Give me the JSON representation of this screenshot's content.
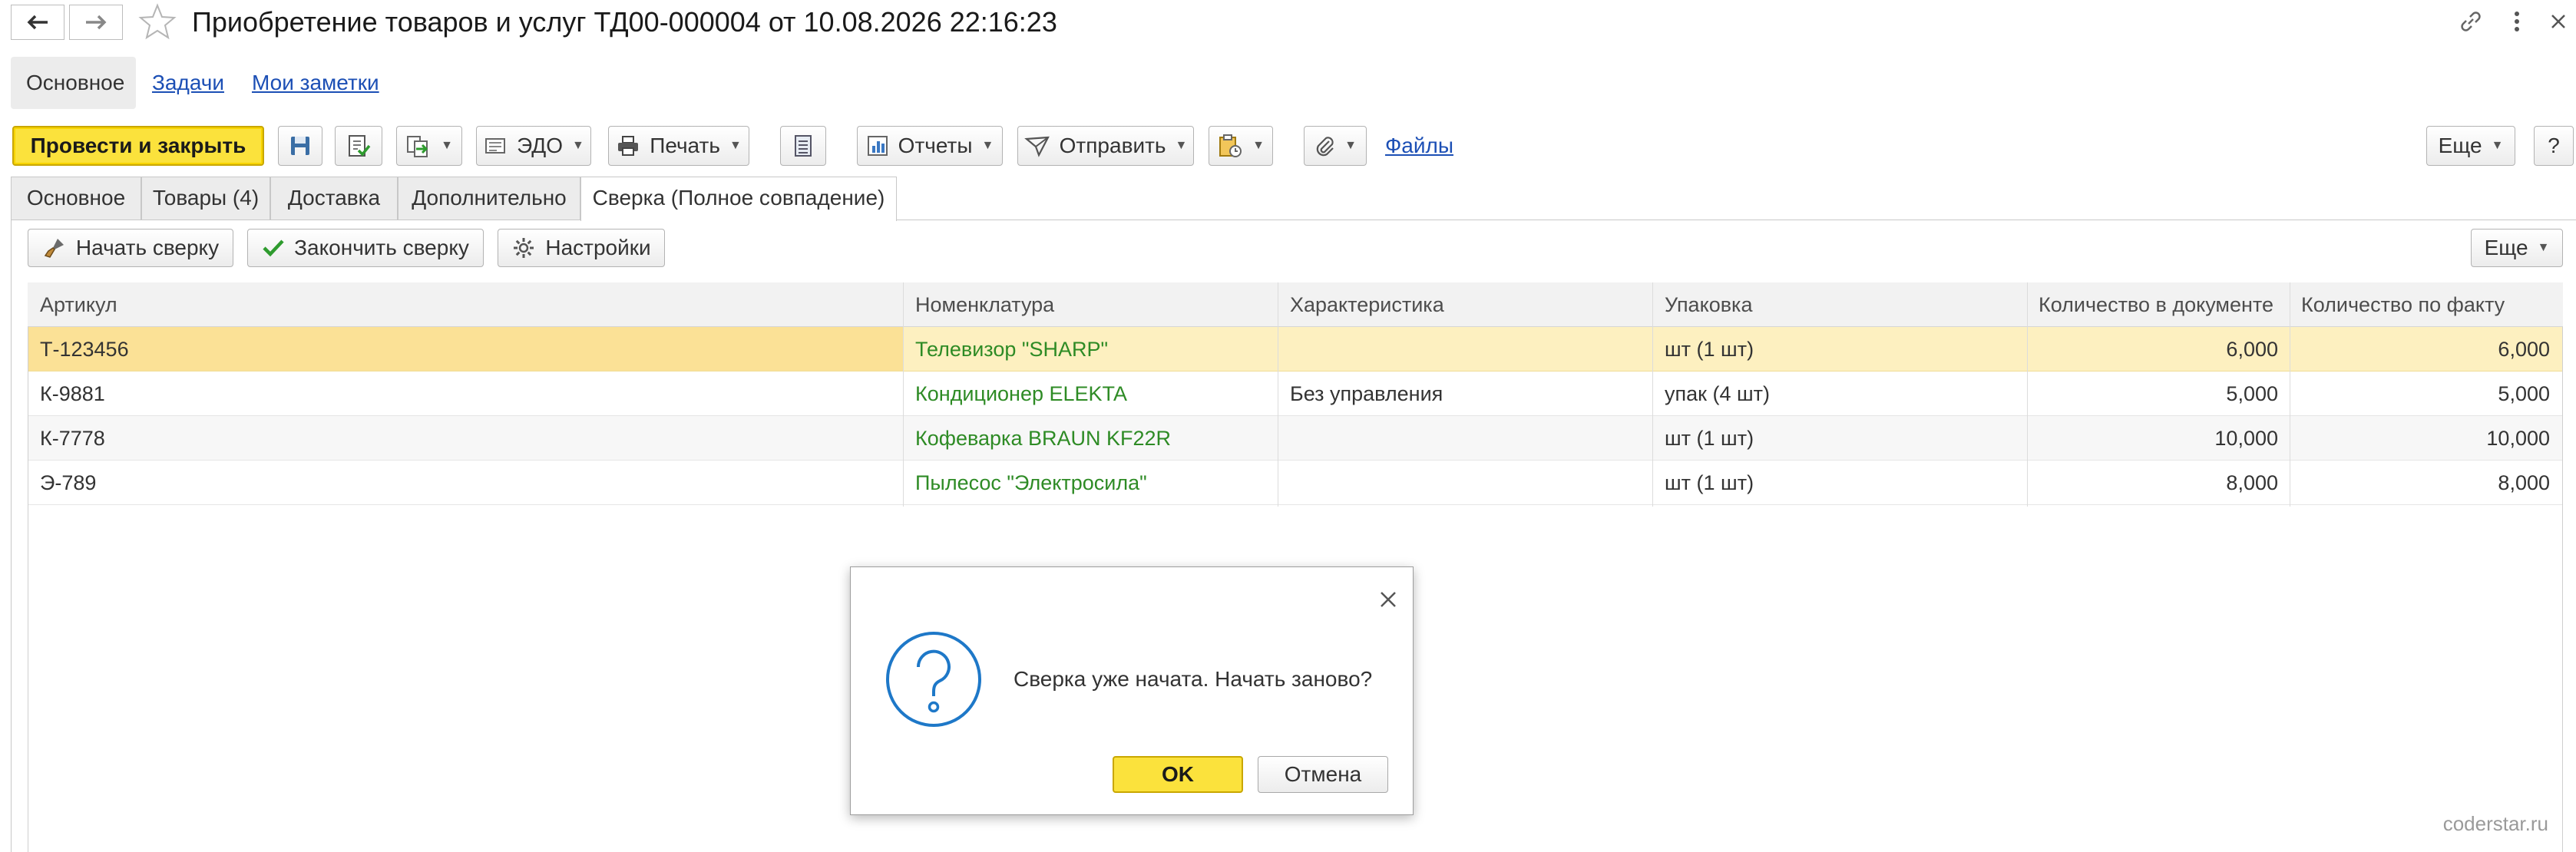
{
  "window": {
    "title": "Приобретение товаров и услуг ТД00-000004 от 10.08.2026 22:16:23"
  },
  "section_tabs": [
    {
      "label": "Основное"
    },
    {
      "label": "Задачи"
    },
    {
      "label": "Мои заметки"
    }
  ],
  "toolbar": {
    "post_close_label": "Провести и закрыть",
    "edo_label": "ЭДО",
    "print_label": "Печать",
    "reports_label": "Отчеты",
    "send_label": "Отправить",
    "files_label": "Файлы",
    "more_label": "Еще",
    "help_label": "?"
  },
  "doc_tabs": [
    {
      "label": "Основное"
    },
    {
      "label": "Товары (4)"
    },
    {
      "label": "Доставка"
    },
    {
      "label": "Дополнительно"
    },
    {
      "label": "Сверка (Полное совпадение)"
    }
  ],
  "reconcile_toolbar": {
    "start_label": "Начать сверку",
    "finish_label": "Закончить сверку",
    "settings_label": "Настройки",
    "more_label": "Еще"
  },
  "table": {
    "columns": [
      "Артикул",
      "Номенклатура",
      "Характеристика",
      "Упаковка",
      "Количество в документе",
      "Количество по факту"
    ],
    "rows": [
      {
        "article": "Т-123456",
        "item": "Телевизор \"SHARP\"",
        "characteristic": "",
        "package": "шт (1 шт)",
        "qty_doc": "6,000",
        "qty_fact": "6,000"
      },
      {
        "article": "К-9881",
        "item": "Кондиционер ELEKTA",
        "characteristic": "Без управления",
        "package": "упак (4 шт)",
        "qty_doc": "5,000",
        "qty_fact": "5,000"
      },
      {
        "article": "К-7778",
        "item": "Кофеварка BRAUN KF22R",
        "characteristic": "",
        "package": "шт (1 шт)",
        "qty_doc": "10,000",
        "qty_fact": "10,000"
      },
      {
        "article": "Э-789",
        "item": "Пылесос \"Электросила\"",
        "characteristic": "",
        "package": "шт (1 шт)",
        "qty_doc": "8,000",
        "qty_fact": "8,000"
      }
    ]
  },
  "dialog": {
    "message": "Сверка уже начата. Начать заново?",
    "ok_label": "OK",
    "cancel_label": "Отмена"
  },
  "watermark": "coderstar.ru",
  "colors": {
    "primary_button": "#fbe23c",
    "selected_row": "#fdf0c0",
    "item_text": "#2e8b25",
    "link": "#1c4fb5",
    "question_icon": "#1e78c8"
  },
  "icons": [
    "back-arrow-icon",
    "forward-arrow-icon",
    "star-icon",
    "link-icon",
    "kebab-menu-icon",
    "close-icon",
    "save-icon",
    "post-icon",
    "create-based-icon",
    "edo-icon",
    "print-icon",
    "journal-icon",
    "reports-icon",
    "send-icon",
    "clipboard-icon",
    "attachment-icon",
    "brush-icon",
    "check-icon",
    "gear-icon",
    "question-icon"
  ]
}
